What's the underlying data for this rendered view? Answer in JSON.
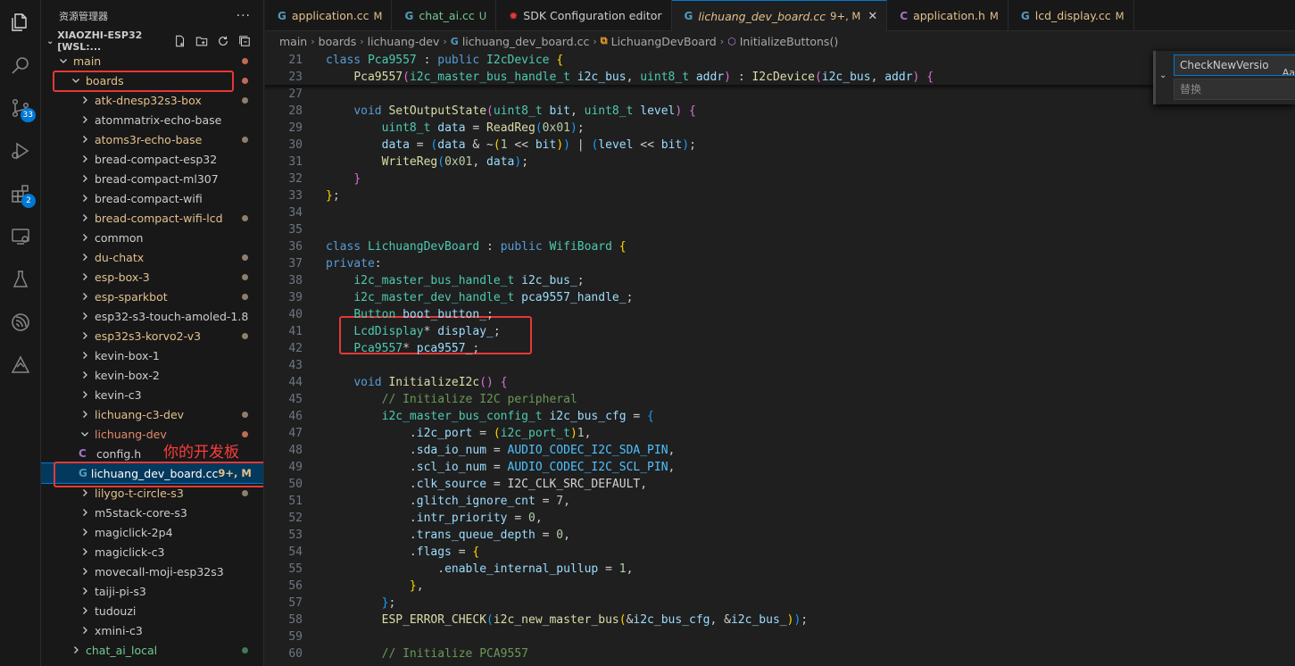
{
  "explorer": {
    "title": "资源管理器",
    "more": "···",
    "workspace": "XIAOZHI-ESP32 [WSL:...",
    "items": [
      {
        "label": "main",
        "depth": 1,
        "open": true,
        "color": "#e2c08d",
        "dot": "#c16a5a"
      },
      {
        "label": "boards",
        "depth": 2,
        "open": true,
        "color": "#e2c08d",
        "dot": "#c16a5a"
      },
      {
        "label": "atk-dnesp32s3-box",
        "depth": 3,
        "open": false,
        "color": "#e2c08d",
        "dot": "#8f7f6a"
      },
      {
        "label": "atommatrix-echo-base",
        "depth": 3,
        "open": false,
        "color": "#cccccc",
        "dot": ""
      },
      {
        "label": "atoms3r-echo-base",
        "depth": 3,
        "open": false,
        "color": "#e2c08d",
        "dot": "#8f7f6a"
      },
      {
        "label": "bread-compact-esp32",
        "depth": 3,
        "open": false,
        "color": "#cccccc",
        "dot": ""
      },
      {
        "label": "bread-compact-ml307",
        "depth": 3,
        "open": false,
        "color": "#cccccc",
        "dot": ""
      },
      {
        "label": "bread-compact-wifi",
        "depth": 3,
        "open": false,
        "color": "#cccccc",
        "dot": ""
      },
      {
        "label": "bread-compact-wifi-lcd",
        "depth": 3,
        "open": false,
        "color": "#e2c08d",
        "dot": "#8f7f6a"
      },
      {
        "label": "common",
        "depth": 3,
        "open": false,
        "color": "#cccccc",
        "dot": ""
      },
      {
        "label": "du-chatx",
        "depth": 3,
        "open": false,
        "color": "#e2c08d",
        "dot": "#8f7f6a"
      },
      {
        "label": "esp-box-3",
        "depth": 3,
        "open": false,
        "color": "#e2c08d",
        "dot": "#8f7f6a"
      },
      {
        "label": "esp-sparkbot",
        "depth": 3,
        "open": false,
        "color": "#e2c08d",
        "dot": "#8f7f6a"
      },
      {
        "label": "esp32-s3-touch-amoled-1.8",
        "depth": 3,
        "open": false,
        "color": "#cccccc",
        "dot": ""
      },
      {
        "label": "esp32s3-korvo2-v3",
        "depth": 3,
        "open": false,
        "color": "#e2c08d",
        "dot": "#8f7f6a"
      },
      {
        "label": "kevin-box-1",
        "depth": 3,
        "open": false,
        "color": "#cccccc",
        "dot": ""
      },
      {
        "label": "kevin-box-2",
        "depth": 3,
        "open": false,
        "color": "#cccccc",
        "dot": ""
      },
      {
        "label": "kevin-c3",
        "depth": 3,
        "open": false,
        "color": "#cccccc",
        "dot": ""
      },
      {
        "label": "lichuang-c3-dev",
        "depth": 3,
        "open": false,
        "color": "#e2c08d",
        "dot": "#8f7f6a"
      },
      {
        "label": "lichuang-dev",
        "depth": 3,
        "open": true,
        "color": "#e08a6c",
        "dot": "#c16a5a"
      },
      {
        "label": "config.h",
        "depth": 4,
        "file": "c",
        "color": "#cccccc",
        "dot": ""
      },
      {
        "label": "lichuang_dev_board.cc",
        "depth": 4,
        "file": "cpp",
        "color": "#ffffff",
        "dot": "",
        "badge": "9+, M",
        "selected": true
      },
      {
        "label": "lilygo-t-circle-s3",
        "depth": 3,
        "open": false,
        "color": "#e2c08d",
        "dot": "#8f7f6a"
      },
      {
        "label": "m5stack-core-s3",
        "depth": 3,
        "open": false,
        "color": "#cccccc",
        "dot": ""
      },
      {
        "label": "magiclick-2p4",
        "depth": 3,
        "open": false,
        "color": "#cccccc",
        "dot": ""
      },
      {
        "label": "magiclick-c3",
        "depth": 3,
        "open": false,
        "color": "#cccccc",
        "dot": ""
      },
      {
        "label": "movecall-moji-esp32s3",
        "depth": 3,
        "open": false,
        "color": "#cccccc",
        "dot": ""
      },
      {
        "label": "taiji-pi-s3",
        "depth": 3,
        "open": false,
        "color": "#cccccc",
        "dot": ""
      },
      {
        "label": "tudouzi",
        "depth": 3,
        "open": false,
        "color": "#cccccc",
        "dot": ""
      },
      {
        "label": "xmini-c3",
        "depth": 3,
        "open": false,
        "color": "#cccccc",
        "dot": ""
      },
      {
        "label": "chat_ai_local",
        "depth": 2,
        "open": false,
        "color": "#73c991",
        "dot": "#3e7a55"
      }
    ],
    "annotation": "你的开发板"
  },
  "activity_bar": {
    "icons": [
      {
        "name": "explorer-icon",
        "badge": ""
      },
      {
        "name": "search-icon",
        "badge": ""
      },
      {
        "name": "source-control-icon",
        "badge": "33"
      },
      {
        "name": "run-debug-icon",
        "badge": ""
      },
      {
        "name": "extensions-icon",
        "badge": "2"
      },
      {
        "name": "remote-explorer-icon",
        "badge": ""
      },
      {
        "name": "testing-icon",
        "badge": ""
      },
      {
        "name": "esp-idf-icon",
        "badge": ""
      },
      {
        "name": "idf-explorer-icon",
        "badge": ""
      }
    ]
  },
  "tabs": [
    {
      "label": "application.cc",
      "status": "M",
      "icon": "cpp",
      "color": "#e2c08d",
      "active": false
    },
    {
      "label": "chat_ai.cc",
      "status": "U",
      "icon": "cpp",
      "color": "#73c991",
      "active": false
    },
    {
      "label": "SDK Configuration editor",
      "status": "",
      "icon": "esp",
      "color": "#cccccc",
      "active": false
    },
    {
      "label": "lichuang_dev_board.cc",
      "status": "9+, M",
      "icon": "cpp",
      "color": "#e2c08d",
      "active": true
    },
    {
      "label": "application.h",
      "status": "M",
      "icon": "c",
      "color": "#e2c08d",
      "active": false
    },
    {
      "label": "lcd_display.cc",
      "status": "M",
      "icon": "cpp",
      "color": "#e2c08d",
      "active": false
    }
  ],
  "breadcrumb": [
    "main",
    "boards",
    "lichuang-dev",
    "lichuang_dev_board.cc",
    "LichuangDevBoard",
    "InitializeButtons()"
  ],
  "find_widget": {
    "find_value": "CheckNewVersio",
    "case_toggle": "Aa",
    "replace_placeholder": "替换"
  },
  "code_lines": [
    {
      "n": "21",
      "html": "<span class=\"kw\">class</span> <span class=\"ty\">Pca9557</span> : <span class=\"kw\">public</span> <span class=\"ty\">I2cDevice</span> <span class=\"br\">{</span>"
    },
    {
      "n": "23",
      "html": "    <span class=\"fn\">Pca9557</span><span class=\"br2\">(</span><span class=\"ty\">i2c_master_bus_handle_t</span> <span class=\"va\">i2c_bus</span>, <span class=\"ty\">uint8_t</span> <span class=\"va\">addr</span><span class=\"br2\">)</span> : <span class=\"fn\">I2cDevice</span><span class=\"br2\">(</span><span class=\"va\">i2c_bus</span>, <span class=\"va\">addr</span><span class=\"br2\">)</span> <span class=\"br2\">{</span>"
    },
    {
      "n": "27",
      "html": ""
    },
    {
      "n": "28",
      "html": "    <span class=\"kw\">void</span> <span class=\"fn\">SetOutputState</span><span class=\"br2\">(</span><span class=\"ty\">uint8_t</span> <span class=\"va\">bit</span>, <span class=\"ty\">uint8_t</span> <span class=\"va\">level</span><span class=\"br2\">)</span> <span class=\"br2\">{</span>"
    },
    {
      "n": "29",
      "html": "        <span class=\"ty\">uint8_t</span> <span class=\"va\">data</span> = <span class=\"fn\">ReadReg</span><span class=\"br3\">(</span><span class=\"nu\">0x01</span><span class=\"br3\">)</span>;"
    },
    {
      "n": "30",
      "html": "        <span class=\"va\">data</span> = <span class=\"br3\">(</span><span class=\"va\">data</span> &amp; ~<span class=\"br\">(</span><span class=\"nu\">1</span> &lt;&lt; <span class=\"va\">bit</span><span class=\"br\">)</span><span class=\"br3\">)</span> | <span class=\"br3\">(</span><span class=\"va\">level</span> &lt;&lt; <span class=\"va\">bit</span><span class=\"br3\">)</span>;"
    },
    {
      "n": "31",
      "html": "        <span class=\"fn\">WriteReg</span><span class=\"br3\">(</span><span class=\"nu\">0x01</span>, <span class=\"va\">data</span><span class=\"br3\">)</span>;"
    },
    {
      "n": "32",
      "html": "    <span class=\"br2\">}</span>"
    },
    {
      "n": "33",
      "html": "<span class=\"br\">}</span>;"
    },
    {
      "n": "34",
      "html": ""
    },
    {
      "n": "35",
      "html": ""
    },
    {
      "n": "36",
      "html": "<span class=\"kw\">class</span> <span class=\"ty\">LichuangDevBoard</span> : <span class=\"kw\">public</span> <span class=\"ty\">WifiBoard</span> <span class=\"br\">{</span>"
    },
    {
      "n": "37",
      "html": "<span class=\"kw\">private</span>:"
    },
    {
      "n": "38",
      "html": "    <span class=\"ty\">i2c_master_bus_handle_t</span> <span class=\"va\">i2c_bus_</span>;"
    },
    {
      "n": "39",
      "html": "    <span class=\"ty\">i2c_master_dev_handle_t</span> <span class=\"va\">pca9557_handle_</span>;"
    },
    {
      "n": "40",
      "html": "    <span class=\"ty\">Button</span> <span class=\"va\">boot_button_</span>;"
    },
    {
      "n": "41",
      "html": "    <span class=\"ty\">LcdDisplay</span>* <span class=\"va\">display_</span>;"
    },
    {
      "n": "42",
      "html": "    <span class=\"ty\">Pca9557</span>* <span class=\"va\">pca9557_</span>;"
    },
    {
      "n": "43",
      "html": ""
    },
    {
      "n": "44",
      "html": "    <span class=\"kw\">void</span> <span class=\"fn\">InitializeI2c</span><span class=\"br2\">()</span> <span class=\"br2\">{</span>"
    },
    {
      "n": "45",
      "html": "        <span class=\"cm\">// Initialize I2C peripheral</span>"
    },
    {
      "n": "46",
      "html": "        <span class=\"ty\">i2c_master_bus_config_t</span> <span class=\"va\">i2c_bus_cfg</span> = <span class=\"br3\">{</span>"
    },
    {
      "n": "47",
      "html": "            .<span class=\"va\">i2c_port</span> = <span class=\"br\">(</span><span class=\"ty\">i2c_port_t</span><span class=\"br\">)</span><span class=\"nu\">1</span>,"
    },
    {
      "n": "48",
      "html": "            .<span class=\"va\">sda_io_num</span> = <span class=\"mc\">AUDIO_CODEC_I2C_SDA_PIN</span>,"
    },
    {
      "n": "49",
      "html": "            .<span class=\"va\">scl_io_num</span> = <span class=\"mc\">AUDIO_CODEC_I2C_SCL_PIN</span>,"
    },
    {
      "n": "50",
      "html": "            .<span class=\"va\">clk_source</span> = <span class=\"op\">I2C_CLK_SRC_DEFAULT</span>,"
    },
    {
      "n": "51",
      "html": "            .<span class=\"va\">glitch_ignore_cnt</span> = <span class=\"nu\">7</span>,"
    },
    {
      "n": "52",
      "html": "            .<span class=\"va\">intr_priority</span> = <span class=\"nu\">0</span>,"
    },
    {
      "n": "53",
      "html": "            .<span class=\"va\">trans_queue_depth</span> = <span class=\"nu\">0</span>,"
    },
    {
      "n": "54",
      "html": "            .<span class=\"va\">flags</span> = <span class=\"br\">{</span>"
    },
    {
      "n": "55",
      "html": "                .<span class=\"va\">enable_internal_pullup</span> = <span class=\"nu\">1</span>,"
    },
    {
      "n": "56",
      "html": "            <span class=\"br\">}</span>,"
    },
    {
      "n": "57",
      "html": "        <span class=\"br3\">}</span>;"
    },
    {
      "n": "58",
      "html": "        <span class=\"fn\">ESP_ERROR_CHECK</span><span class=\"br3\">(</span><span class=\"fn\">i2c_new_master_bus</span><span class=\"br\">(</span>&amp;<span class=\"va\">i2c_bus_cfg</span>, &amp;<span class=\"va\">i2c_bus_</span><span class=\"br\">)</span><span class=\"br3\">)</span>;"
    },
    {
      "n": "59",
      "html": ""
    },
    {
      "n": "60",
      "html": "        <span class=\"cm\">// Initialize PCA9557</span>"
    }
  ],
  "code_text": [
    "class Pca9557 : public I2cDevice {",
    "    Pca9557(i2c_master_bus_handle_t i2c_bus, uint8_t addr) : I2cDevice(i2c_bus, addr) {"
  ]
}
